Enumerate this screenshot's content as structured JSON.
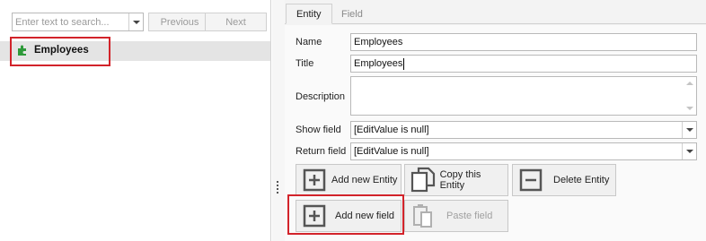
{
  "left_pane": {
    "search": {
      "placeholder": "Enter text to search...",
      "value": ""
    },
    "previous_label": "Previous",
    "next_label": "Next",
    "tree": {
      "items": [
        {
          "label": "Employees",
          "selected": true
        }
      ]
    }
  },
  "right_pane": {
    "tabs": [
      {
        "label": "Entity",
        "active": true
      },
      {
        "label": "Field",
        "active": false
      }
    ],
    "form": {
      "name_label": "Name",
      "name_value": "Employees",
      "title_label": "Title",
      "title_value": "Employees",
      "description_label": "Description",
      "description_value": "",
      "show_field_label": "Show field",
      "show_field_value": "[EditValue is null]",
      "return_field_label": "Return field",
      "return_field_value": "[EditValue is null]"
    },
    "buttons": {
      "add_entity": "Add new Entity",
      "copy_entity": "Copy this Entity",
      "delete_entity": "Delete Entity",
      "add_field": "Add new field",
      "paste_field": "Paste field"
    }
  },
  "colors": {
    "highlight": "#d2232a",
    "icon_gray": "#555555",
    "icon_green": "#2e9a3a",
    "selection_bg": "#e4e4e4"
  }
}
